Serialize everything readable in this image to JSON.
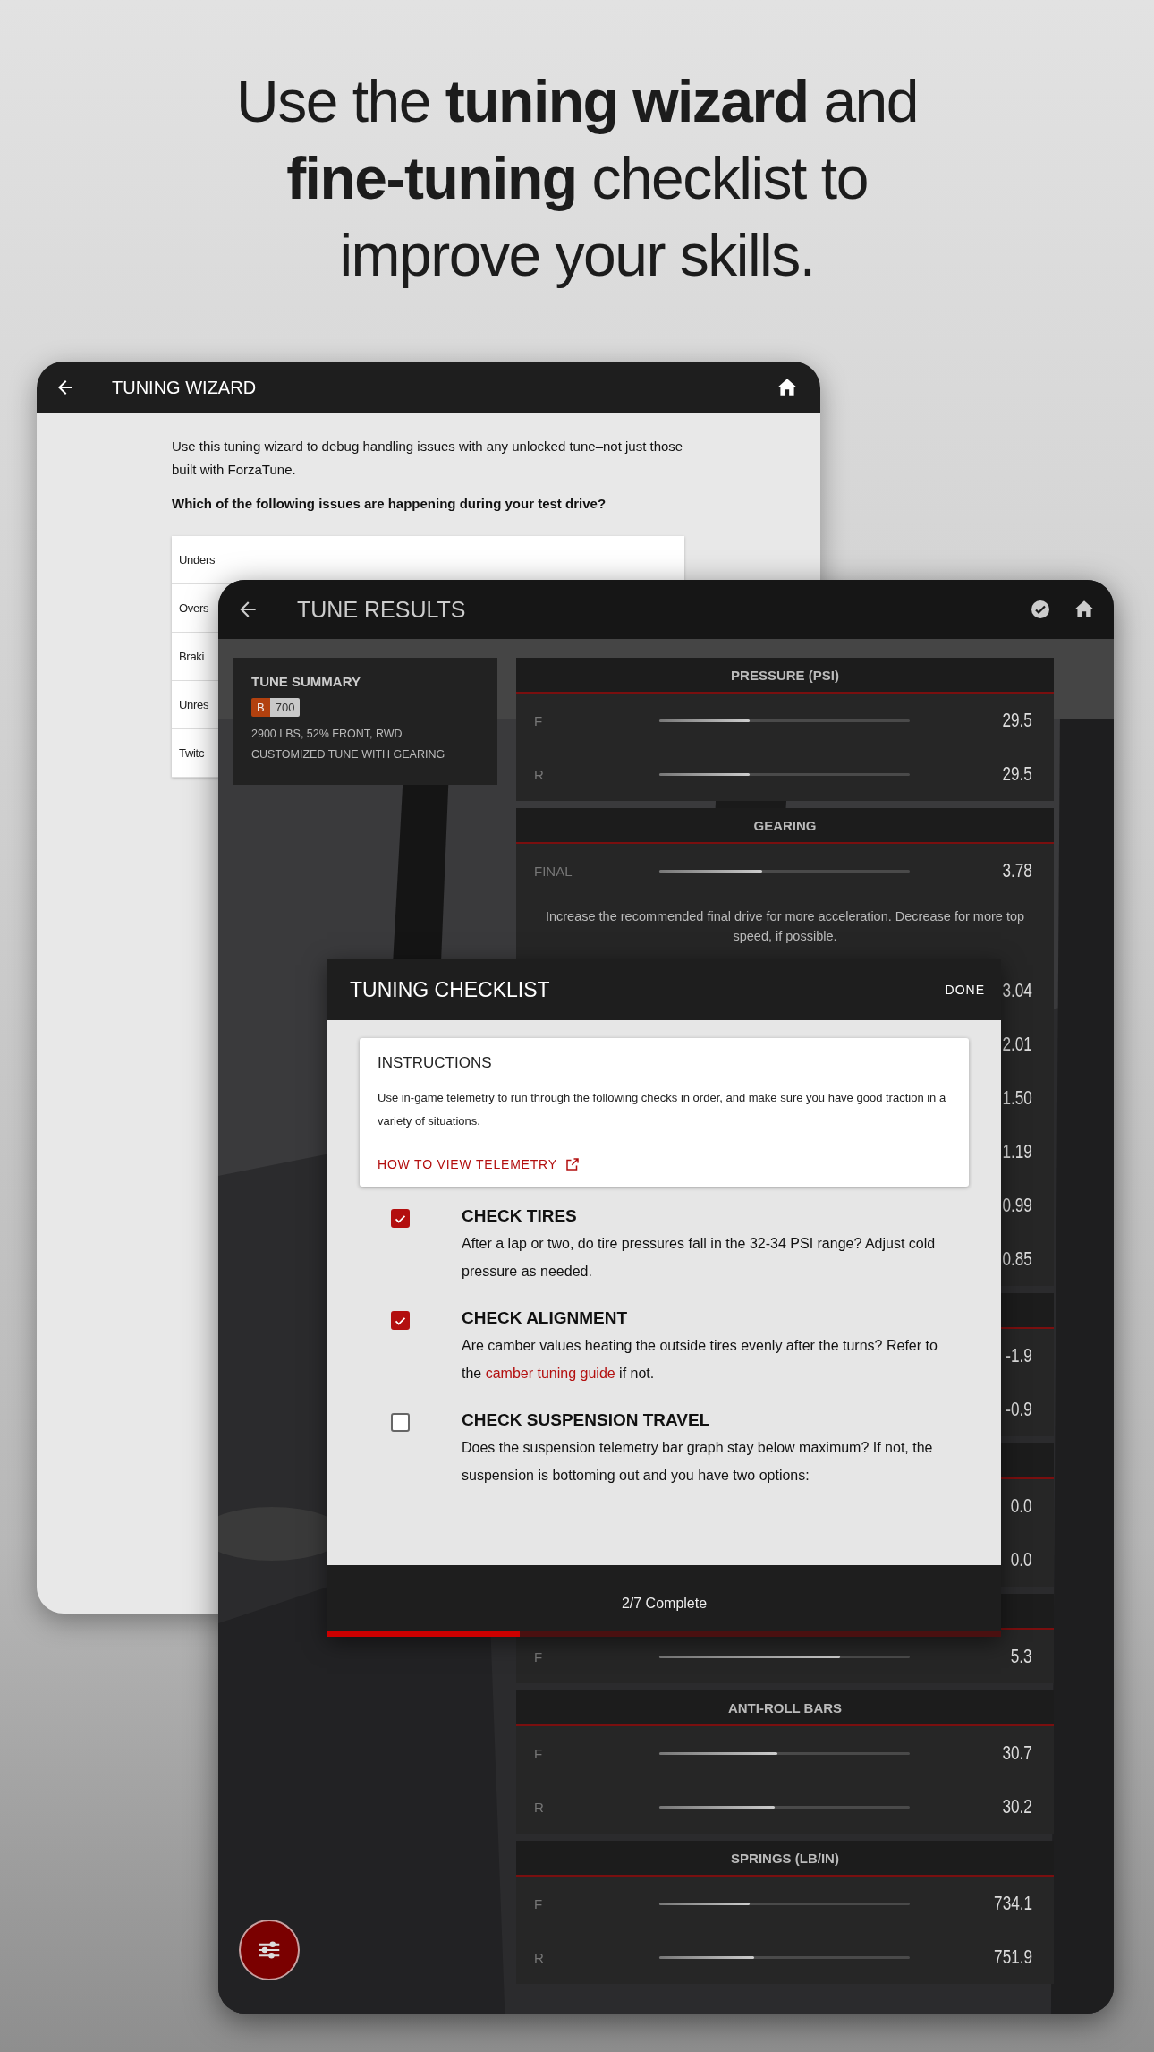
{
  "headline": "Use the **tuning wizard** and **fine-tuning** checklist to improve your skills.",
  "wizard": {
    "title": "TUNING WIZARD",
    "intro": "Use this tuning wizard to debug handling issues with any unlocked tune–not just those built with ForzaTune.",
    "question": "Which of the following issues are happening during your test drive?",
    "options": [
      "Unders",
      "Overs",
      "Braki",
      "Unres",
      "Twitc"
    ]
  },
  "results": {
    "title": "TUNE RESULTS",
    "summary": {
      "title": "TUNE SUMMARY",
      "class_letter": "B",
      "rating": "700",
      "specs": "2900 LBS, 52% FRONT, RWD",
      "note": "CUSTOMIZED TUNE WITH GEARING"
    },
    "sections": [
      {
        "title": "PRESSURE (PSI)",
        "rows": [
          {
            "kind": "slider",
            "label": "F",
            "level": 0.36,
            "value": "29.5"
          },
          {
            "kind": "slider",
            "label": "R",
            "level": 0.36,
            "value": "29.5"
          }
        ]
      },
      {
        "title": "GEARING",
        "rows": [
          {
            "kind": "slider",
            "label": "FINAL",
            "level": 0.41,
            "value": "3.78"
          },
          {
            "kind": "note",
            "text": "Increase the recommended final drive for more acceleration. Decrease for more top speed, if possible."
          },
          {
            "kind": "value",
            "value": "3.04"
          },
          {
            "kind": "value",
            "value": "2.01"
          },
          {
            "kind": "value",
            "value": "1.50"
          },
          {
            "kind": "value",
            "value": "1.19"
          },
          {
            "kind": "value",
            "value": "0.99"
          },
          {
            "kind": "value",
            "value": "0.85"
          }
        ]
      },
      {
        "rows": [
          {
            "kind": "value",
            "value": "-1.9"
          },
          {
            "kind": "value",
            "value": "-0.9"
          }
        ]
      },
      {
        "rows": [
          {
            "kind": "value",
            "value": "0.0"
          },
          {
            "kind": "value",
            "value": "0.0"
          }
        ]
      },
      {
        "rows": [
          {
            "kind": "slider",
            "label": "F",
            "level": 0.72,
            "value": "5.3"
          }
        ]
      },
      {
        "title": "ANTI-ROLL BARS",
        "rows": [
          {
            "kind": "slider",
            "label": "F",
            "level": 0.47,
            "value": "30.7"
          },
          {
            "kind": "slider",
            "label": "R",
            "level": 0.46,
            "value": "30.2"
          }
        ]
      },
      {
        "title": "SPRINGS (LB/IN)",
        "rows": [
          {
            "kind": "slider",
            "label": "F",
            "level": 0.36,
            "value": "734.1"
          },
          {
            "kind": "slider",
            "label": "R",
            "level": 0.38,
            "value": "751.9"
          }
        ]
      }
    ]
  },
  "checklist": {
    "title": "TUNING CHECKLIST",
    "done": "DONE",
    "instructions": {
      "title": "INSTRUCTIONS",
      "text": "Use in-game telemetry to run through the following checks in order, and make sure you have good traction in a variety of situations.",
      "link": "HOW TO VIEW TELEMETRY"
    },
    "items": [
      {
        "title": "CHECK TIRES",
        "checked": true,
        "text": [
          {
            "kind": "text",
            "text": "After a lap or two, do tire pressures fall in the 32-34 PSI range? Adjust cold pressure as needed."
          }
        ]
      },
      {
        "title": "CHECK ALIGNMENT",
        "checked": true,
        "text": [
          {
            "kind": "text",
            "text": "Are camber values heating the outside tires evenly after the turns? Refer to the "
          },
          {
            "kind": "link",
            "text": "camber tuning guide"
          },
          {
            "kind": "text",
            "text": " if not."
          }
        ]
      },
      {
        "title": "CHECK SUSPENSION TRAVEL",
        "checked": false,
        "text": [
          {
            "kind": "text",
            "text": "Does the suspension telemetry bar graph stay below maximum? If not, the suspension is bottoming out and you have two options:"
          }
        ]
      }
    ],
    "progress": {
      "label": "2/7 Complete",
      "level": 0.286
    }
  }
}
